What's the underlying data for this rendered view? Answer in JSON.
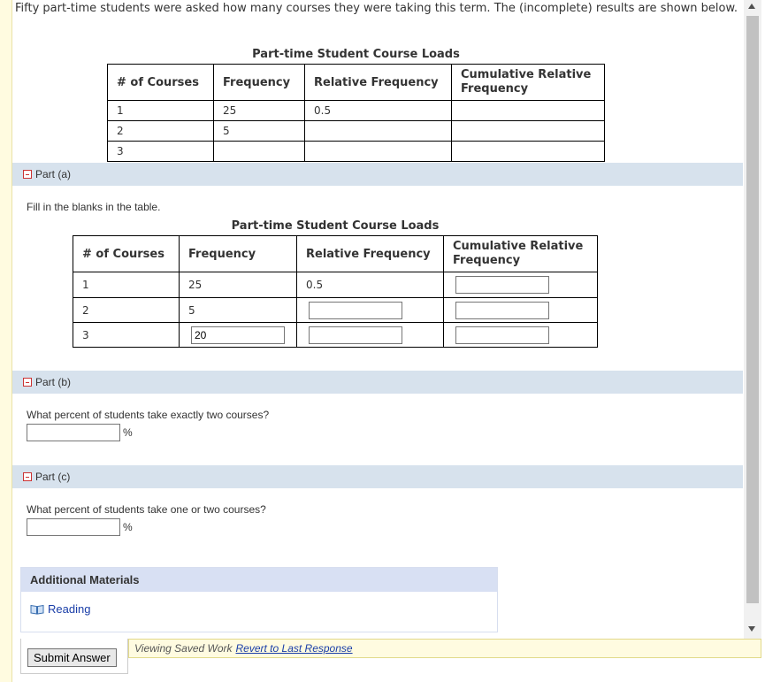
{
  "intro": "Fifty part-time students were asked how many courses they were taking this term. The (incomplete) results are shown below.",
  "table_title": "Part-time Student Course Loads",
  "table_headers": [
    "# of Courses",
    "Frequency",
    "Relative Frequency",
    "Cumulative Relative Frequency"
  ],
  "given_table": {
    "rows": [
      {
        "courses": "1",
        "frequency": "25",
        "relative": "0.5",
        "cumulative": ""
      },
      {
        "courses": "2",
        "frequency": "5",
        "relative": "",
        "cumulative": ""
      },
      {
        "courses": "3",
        "frequency": "",
        "relative": "",
        "cumulative": ""
      }
    ]
  },
  "part_a": {
    "label": "Part (a)",
    "prompt": "Fill in the blanks in the table.",
    "rows": [
      {
        "courses": "1",
        "frequency": "25",
        "relative": "0.5",
        "cumulative_input": ""
      },
      {
        "courses": "2",
        "frequency": "5",
        "relative_input": "",
        "cumulative_input": ""
      },
      {
        "courses": "3",
        "frequency_input": "20",
        "relative_input": "",
        "cumulative_input": ""
      }
    ]
  },
  "part_b": {
    "label": "Part (b)",
    "prompt": "What percent of students take exactly two courses?",
    "answer": "",
    "unit": "%"
  },
  "part_c": {
    "label": "Part (c)",
    "prompt": "What percent of students take one or two courses?",
    "answer": "",
    "unit": "%"
  },
  "materials": {
    "heading": "Additional Materials",
    "link": "Reading",
    "icon": "book-icon"
  },
  "footer": {
    "submit": "Submit Answer",
    "saved_text": "Viewing Saved Work",
    "revert_link": "Revert to Last Response"
  },
  "colors": {
    "part_bar": "#d7e2ed",
    "given_value": "#c00000",
    "link": "#1a3ea8",
    "saved_bar": "#fffbe0"
  }
}
